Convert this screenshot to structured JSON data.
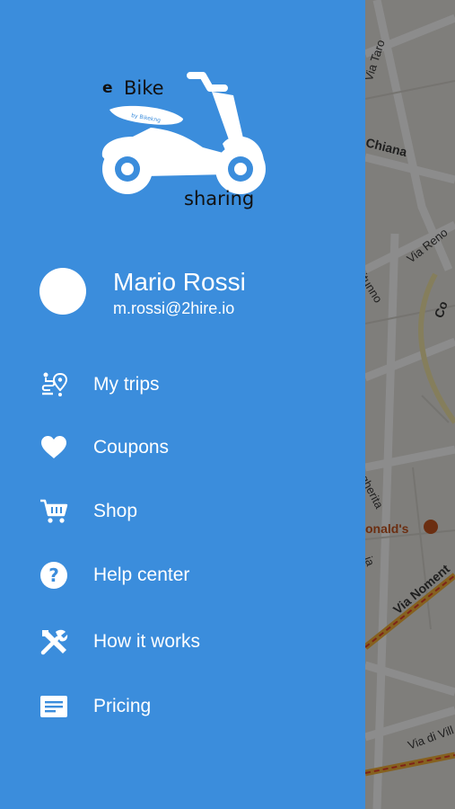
{
  "map": {
    "labels": {
      "via_taro": "Via Taro",
      "chiana": "Chiana",
      "via_reno": "Via Reno",
      "itunno": "itunno",
      "co": "Co",
      "gherita": "gherita",
      "poi": "onald's",
      "ia": "ia",
      "via_nomentana": "Via Noment",
      "via_di_vill": "Via di Vill"
    }
  },
  "logo": {
    "e": "e",
    "bike": "Bike",
    "sharing": "sharing",
    "tag": "by Bikekng"
  },
  "user": {
    "name": "Mario Rossi",
    "email": "m.rossi@2hire.io"
  },
  "menu": {
    "items": [
      {
        "label": "My trips",
        "icon": "route-icon"
      },
      {
        "label": "Coupons",
        "icon": "heart-icon"
      },
      {
        "label": "Shop",
        "icon": "cart-icon"
      },
      {
        "label": "Help center",
        "icon": "help-icon"
      },
      {
        "label": "How it works",
        "icon": "tools-icon"
      },
      {
        "label": "Pricing",
        "icon": "receipt-icon"
      }
    ]
  },
  "colors": {
    "drawer": "#3b8ddc",
    "overlay": "rgba(0,0,0,0.45)"
  }
}
